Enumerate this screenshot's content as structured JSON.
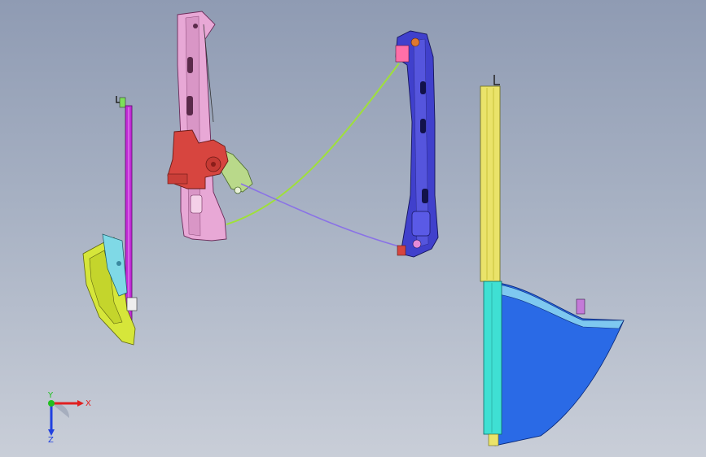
{
  "viewport": {
    "background_top": "#8f9bb3",
    "background_bottom": "#c9ced8"
  },
  "parts": [
    {
      "name": "left-glass-channel",
      "color": "#c12bd6"
    },
    {
      "name": "left-lower-bracket",
      "color": "#d6e63a"
    },
    {
      "name": "left-latch-plate",
      "color": "#7fd9e6"
    },
    {
      "name": "center-rail",
      "color": "#e8a8d6"
    },
    {
      "name": "motor-drive",
      "color": "#d7453f"
    },
    {
      "name": "pulley-bracket",
      "color": "#b9d98a"
    },
    {
      "name": "cable-green",
      "color": "#9fe03a"
    },
    {
      "name": "cable-purple",
      "color": "#8a72e6"
    },
    {
      "name": "right-rail",
      "color": "#4040cc"
    },
    {
      "name": "glass-edge-strip-upper",
      "color": "#eae36a"
    },
    {
      "name": "glass-edge-strip-lower",
      "color": "#3fe0d3"
    },
    {
      "name": "door-glass",
      "color": "#2a6ae6"
    }
  ],
  "axis_triad": {
    "x_label": "X",
    "y_label": "Y",
    "z_label": "Z",
    "x_color": "#e02020",
    "y_color": "#20c020",
    "z_color": "#2040e0"
  }
}
